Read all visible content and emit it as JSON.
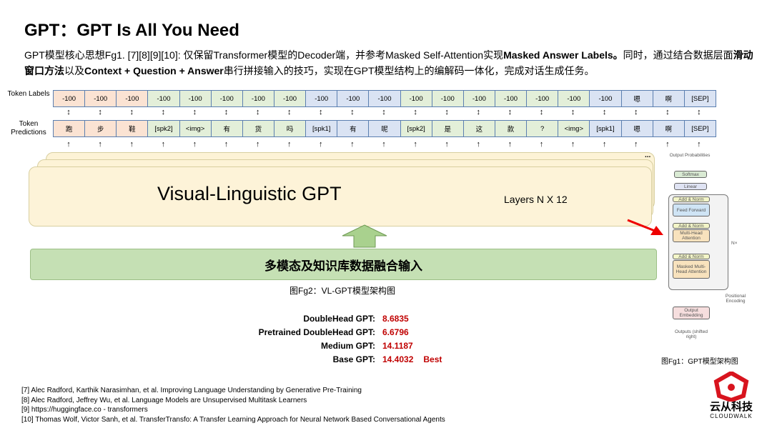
{
  "title": "GPT：GPT Is All You Need",
  "intro": {
    "p1": "GPT模型核心思想Fg1. [7][8][9][10]: 仅保留Transformer模型的Decoder端，并参考Masked Self-Attention实现",
    "b1": "Masked Answer Labels。",
    "p2": "同时，通过结合数据层面",
    "b2": "滑动窗口方法",
    "p3": "以及",
    "b3": "Context + Question + Answer",
    "p4": "串行拼接输入的技巧，实现在GPT模型结构上的编解码一体化，完成对话生成任务。"
  },
  "token_labels_title": "Token Labels",
  "token_predictions_title": "Token Predictions",
  "token_labels": [
    "-100",
    "-100",
    "-100",
    "-100",
    "-100",
    "-100",
    "-100",
    "-100",
    "-100",
    "-100",
    "-100",
    "-100",
    "-100",
    "-100",
    "-100",
    "-100",
    "-100",
    "-100",
    "嗯",
    "啊",
    "[SEP]"
  ],
  "token_predictions": [
    "跑",
    "步",
    "鞋",
    "[spk2]",
    "<img>",
    "有",
    "货",
    "吗",
    "[spk1]",
    "有",
    "呢",
    "[spk2]",
    "是",
    "这",
    "款",
    "?",
    "<img>",
    "[spk1]",
    "嗯",
    "啊",
    "[SEP]"
  ],
  "segment_colors": [
    "o",
    "o",
    "o",
    "g",
    "g",
    "g",
    "g",
    "g",
    "b",
    "b",
    "b",
    "g",
    "g",
    "g",
    "g",
    "g",
    "g",
    "b",
    "b",
    "b",
    "b"
  ],
  "arrow_bidir": "↕",
  "arrow_up": "↑",
  "ellipsis": "...",
  "model_title": "Visual-Linguistic GPT",
  "layers": "Layers  N X 12",
  "input_label": "多模态及知识库数据融合输入",
  "caption_fg2": "图Fg2：VL-GPT模型架构图",
  "scores": [
    {
      "name": "DoubleHead GPT:",
      "value": "8.6835",
      "note": ""
    },
    {
      "name": "Pretrained DoubleHead GPT:",
      "value": "6.6796",
      "note": ""
    },
    {
      "name": "Medium GPT:",
      "value": "14.1187",
      "note": ""
    },
    {
      "name": "Base GPT:",
      "value": "14.4032",
      "note": "Best"
    }
  ],
  "transformer": {
    "out_probs": "Output Probabilities",
    "softmax": "Softmax",
    "linear": "Linear",
    "addnorm": "Add & Norm",
    "ff": "Feed Forward",
    "mha": "Multi-Head Attention",
    "mmha": "Masked Multi-Head Attention",
    "nx": "N×",
    "pos": "Positional Encoding",
    "emb": "Output Embedding",
    "outputs": "Outputs (shifted right)"
  },
  "caption_fg1": "图Fg1：GPT模型架构图",
  "references": [
    "[7] Alec Radford, Karthik Narasimhan, et al. Improving Language Understanding by Generative Pre-Training",
    "[8] Alec Radford, Jeffrey Wu,  et al. Language Models are Unsupervised Multitask Learners",
    "[9] https://huggingface.co - transformers",
    "[10] Thomas Wolf, Victor Sanh, et al. TransferTransfo: A Transfer Learning Approach for Neural Network Based Conversational Agents"
  ],
  "logo": {
    "cn": "云从科技",
    "en": "CLOUDWALK"
  },
  "colors": {
    "accent_red": "#c00000",
    "orange": "#fbe3d3",
    "green": "#e3efd9",
    "blue": "#dae3f3"
  }
}
